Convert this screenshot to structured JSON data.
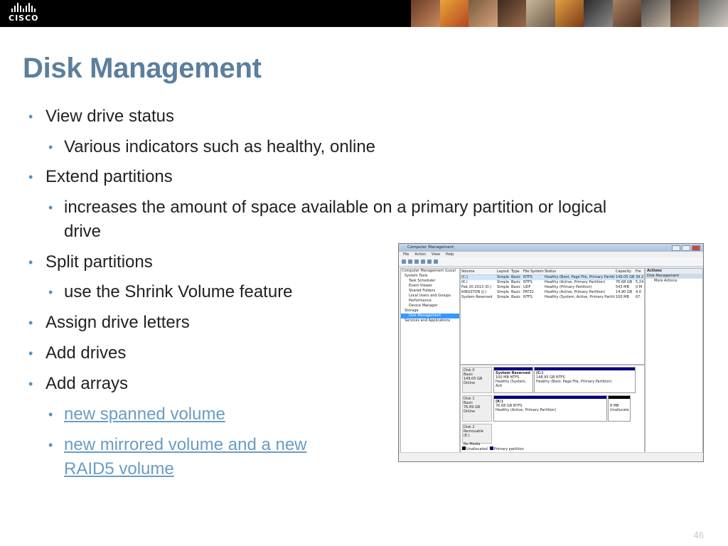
{
  "header": {
    "logo_text": "CISCO",
    "brand_bg": "#000000"
  },
  "slide": {
    "title": "Disk Management",
    "title_color": "#5b7f9d",
    "page_number": "46",
    "bullets": [
      {
        "level": 1,
        "text": "View drive status"
      },
      {
        "level": 2,
        "text": "Various indicators such as healthy, online"
      },
      {
        "level": 1,
        "text": "Extend partitions"
      },
      {
        "level": 2,
        "text": "increases the amount of space available on a primary partition or logical drive"
      },
      {
        "level": 1,
        "text": "Split partitions"
      },
      {
        "level": 2,
        "text": "use the Shrink Volume feature"
      },
      {
        "level": 1,
        "text": "Assign drive letters"
      },
      {
        "level": 1,
        "text": "Add drives"
      },
      {
        "level": 1,
        "text": "Add arrays"
      },
      {
        "level": 2,
        "text": "new spanned volume",
        "link": true
      },
      {
        "level": 2,
        "text": "new mirrored volume and a new RAID5 volume",
        "link": true
      }
    ]
  },
  "screenshot": {
    "window_title": "Computer Management",
    "menu": [
      "File",
      "Action",
      "View",
      "Help"
    ],
    "tree": [
      "Computer Management (Local",
      "System Tools",
      "Task Scheduler",
      "Event Viewer",
      "Shared Folders",
      "Local Users and Groups",
      "Performance",
      "Device Manager",
      "Storage",
      "Disk Management",
      "Services and Applications"
    ],
    "volume_headers": [
      "Volume",
      "Layout",
      "Type",
      "File System",
      "Status",
      "Capacity",
      "Fre"
    ],
    "volumes": [
      [
        "(C:)",
        "Simple",
        "Basic",
        "NTFS",
        "Healthy (Boot, Page File, Primary Partition)",
        "149.05 GB",
        "39.2"
      ],
      [
        "(K:)",
        "Simple",
        "Basic",
        "NTFS",
        "Healthy (Active, Primary Partition)",
        "76.68 GB",
        "5.24"
      ],
      [
        "Feb 20 2013 (D:)",
        "Simple",
        "Basic",
        "UDF",
        "Healthy (Primary Partition)",
        "543 MB",
        "0 M"
      ],
      [
        "KINGSTON (J:)",
        "Simple",
        "Basic",
        "FAT32",
        "Healthy (Active, Primary Partition)",
        "14.90 GB",
        "4.0"
      ],
      [
        "System Reserved",
        "Simple",
        "Basic",
        "NTFS",
        "Healthy (System, Active, Primary Partition)",
        "100 MB",
        "67."
      ]
    ],
    "disks": [
      {
        "label": "Disk 0",
        "type": "Basic",
        "size": "149.05 GB",
        "state": "Online",
        "parts": [
          {
            "name": "System Reserved",
            "size": "100 MB NTFS",
            "status": "Healthy (System, Acti"
          },
          {
            "name": "(C:)",
            "size": "148.95 GB NTFS",
            "status": "Healthy (Boot, Page File, Primary Partition)"
          }
        ]
      },
      {
        "label": "Disk 1",
        "type": "Basic",
        "size": "76.69 GB",
        "state": "Online",
        "parts": [
          {
            "name": "(K:)",
            "size": "76.68 GB NTFS",
            "status": "Healthy (Active, Primary Partition)"
          },
          {
            "name": "",
            "size": "8 MB",
            "status": "Unallocate"
          }
        ]
      },
      {
        "label": "Disk 2",
        "type": "Removable (E:)",
        "size": "",
        "state": "No Media",
        "parts": []
      }
    ],
    "legend": [
      "Unallocated",
      "Primary partition"
    ],
    "actions": {
      "header": "Actions",
      "section": "Disk Management",
      "more": "More Actions"
    }
  }
}
